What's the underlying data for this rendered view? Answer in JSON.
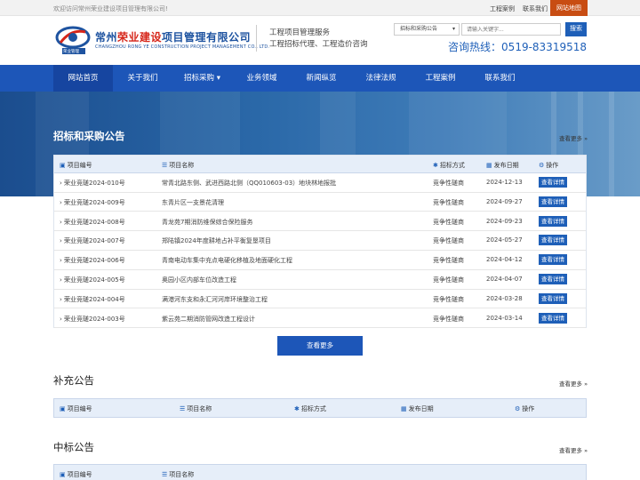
{
  "topbar": {
    "welcome": "欢迎访问常州荣业建设项目管理有限公司!",
    "links": [
      "工程案例",
      "联系我们",
      "网站地图"
    ]
  },
  "header": {
    "brand_left": "常州",
    "brand_red": "荣业建设",
    "brand_right": "项目管理有限公司",
    "brand_en": "CHANGZHOU RONG YE CONSTRUCTION PROJECT MANAGEMENT CO., LTD.",
    "logo_caption": "荣业管理",
    "slogan1": "工程项目管理服务",
    "slogan2": "工程招标代理、工程造价咨询",
    "search_select": "招标和采购公告",
    "search_placeholder": "请输入关键字...",
    "search_button": "搜索",
    "hotline": "咨询热线：0519-83319518"
  },
  "nav": [
    "网站首页",
    "关于我们",
    "招标采购",
    "业务领域",
    "新闻纵览",
    "法律法规",
    "工程案例",
    "联系我们"
  ],
  "colors": {
    "primary": "#1d56b8",
    "accent": "#c84d13",
    "brand_red": "#d6261a"
  },
  "section1": {
    "title": "招标和采购公告",
    "more": "查看更多 »",
    "headers": [
      "项目编号",
      "项目名称",
      "招标方式",
      "发布日期",
      "操作"
    ],
    "rows": [
      {
        "id": "荣业竞磋2024-010号",
        "name": "常青北路东侧、武进西路北侧（QQ010603-03）地块林地报批",
        "method": "竞争性磋商",
        "date": "2024-12-13",
        "action": "查看详情"
      },
      {
        "id": "荣业竞磋2024-009号",
        "name": "东青片区一支景花清理",
        "method": "竞争性磋商",
        "date": "2024-09-27",
        "action": "查看详情"
      },
      {
        "id": "荣业竞磋2024-008号",
        "name": "青龙苑7期消防维保综合保险服务",
        "method": "竞争性磋商",
        "date": "2024-09-23",
        "action": "查看详情"
      },
      {
        "id": "荣业竞磋2024-007号",
        "name": "郑陆镇2024年度耕地占补平衡复垦项目",
        "method": "竞争性磋商",
        "date": "2024-05-27",
        "action": "查看详情"
      },
      {
        "id": "荣业竞磋2024-006号",
        "name": "青南电动车集中充点电硬化移植及地面硬化工程",
        "method": "竞争性磋商",
        "date": "2024-04-12",
        "action": "查看详情"
      },
      {
        "id": "荣业竞磋2024-005号",
        "name": "奥园小区内部车位改造工程",
        "method": "竞争性磋商",
        "date": "2024-04-07",
        "action": "查看详情"
      },
      {
        "id": "荣业竞磋2024-004号",
        "name": "满港河东支和永汇河河岸环境整治工程",
        "method": "竞争性磋商",
        "date": "2024-03-28",
        "action": "查看详情"
      },
      {
        "id": "荣业竞磋2024-003号",
        "name": "紫云苑二期消防管网改造工程设计",
        "method": "竞争性磋商",
        "date": "2024-03-14",
        "action": "查看详情"
      }
    ],
    "more_button": "查看更多"
  },
  "section2": {
    "title": "补充公告",
    "more": "查看更多 »",
    "headers": [
      "项目编号",
      "项目名称",
      "招标方式",
      "发布日期",
      "操作"
    ]
  },
  "section3": {
    "title": "中标公告",
    "more": "查看更多 »",
    "headers": [
      "项目编号",
      "项目名称"
    ]
  }
}
